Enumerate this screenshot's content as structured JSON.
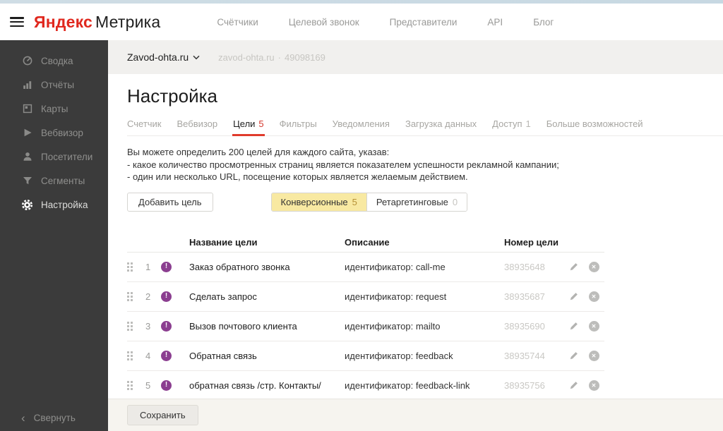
{
  "top_nav": {
    "logo": {
      "brand": "Яндекс",
      "product": "Метрика"
    },
    "items": [
      {
        "label": "Счётчики"
      },
      {
        "label": "Целевой звонок"
      },
      {
        "label": "Представители"
      },
      {
        "label": "API"
      },
      {
        "label": "Блог"
      }
    ]
  },
  "sidebar": {
    "items": [
      {
        "label": "Сводка",
        "icon": "gauge-icon",
        "active": false
      },
      {
        "label": "Отчёты",
        "icon": "bar-chart-icon",
        "active": false
      },
      {
        "label": "Карты",
        "icon": "layout-icon",
        "active": false
      },
      {
        "label": "Вебвизор",
        "icon": "play-icon",
        "active": false
      },
      {
        "label": "Посетители",
        "icon": "person-icon",
        "active": false
      },
      {
        "label": "Сегменты",
        "icon": "funnel-icon",
        "active": false
      },
      {
        "label": "Настройка",
        "icon": "gear-icon",
        "active": true
      }
    ],
    "collapse": {
      "label": "Свернуть",
      "chevron": "‹"
    }
  },
  "breadcrumb": {
    "site": "Zavod-ohta.ru",
    "domain": "zavod-ohta.ru",
    "separator": "·",
    "counter_id": "49098169"
  },
  "page": {
    "title": "Настройка"
  },
  "tabs": [
    {
      "label": "Счетчик"
    },
    {
      "label": "Вебвизор"
    },
    {
      "label": "Цели",
      "count": "5",
      "active": true
    },
    {
      "label": "Фильтры"
    },
    {
      "label": "Уведомления"
    },
    {
      "label": "Загрузка данных"
    },
    {
      "label": "Доступ",
      "count": "1"
    },
    {
      "label": "Больше возможностей"
    }
  ],
  "description": {
    "intro": "Вы можете определить 200 целей для каждого сайта, указав:",
    "bullets": [
      "-  какое количество просмотренных страниц является показателем успешности рекламной кампании;",
      "-  один или несколько URL, посещение которых является желаемым действием."
    ]
  },
  "toolbar": {
    "add_goal_label": "Добавить цель",
    "filters": [
      {
        "label": "Конверсионные",
        "count": "5",
        "active": true
      },
      {
        "label": "Ретаргетинговые",
        "count": "0",
        "active": false
      }
    ]
  },
  "goals_table": {
    "headers": {
      "name": "Название цели",
      "description": "Описание",
      "number": "Номер цели"
    },
    "badge_glyph": "!",
    "rows": [
      {
        "index": "1",
        "name": "Заказ обратного звонка",
        "description": "идентификатор: call-me",
        "number": "38935648"
      },
      {
        "index": "2",
        "name": "Сделать запрос",
        "description": "идентификатор: request",
        "number": "38935687"
      },
      {
        "index": "3",
        "name": "Вызов почтового клиента",
        "description": "идентификатор: mailto",
        "number": "38935690"
      },
      {
        "index": "4",
        "name": "Обратная связь",
        "description": "идентификатор: feedback",
        "number": "38935744"
      },
      {
        "index": "5",
        "name": "обратная связь /стр. Контакты/",
        "description": "идентификатор: feedback-link",
        "number": "38935756"
      }
    ]
  },
  "footer": {
    "save_label": "Сохранить"
  },
  "colors": {
    "accent_red": "#e0281e",
    "tab_underline_red": "#e03b2c",
    "goal_badge_purple": "#8b3e90",
    "filter_active_yellow": "#f8e9a2",
    "sidebar_bg": "#3b3b3b",
    "top_strip_blue": "#cfdde5"
  }
}
